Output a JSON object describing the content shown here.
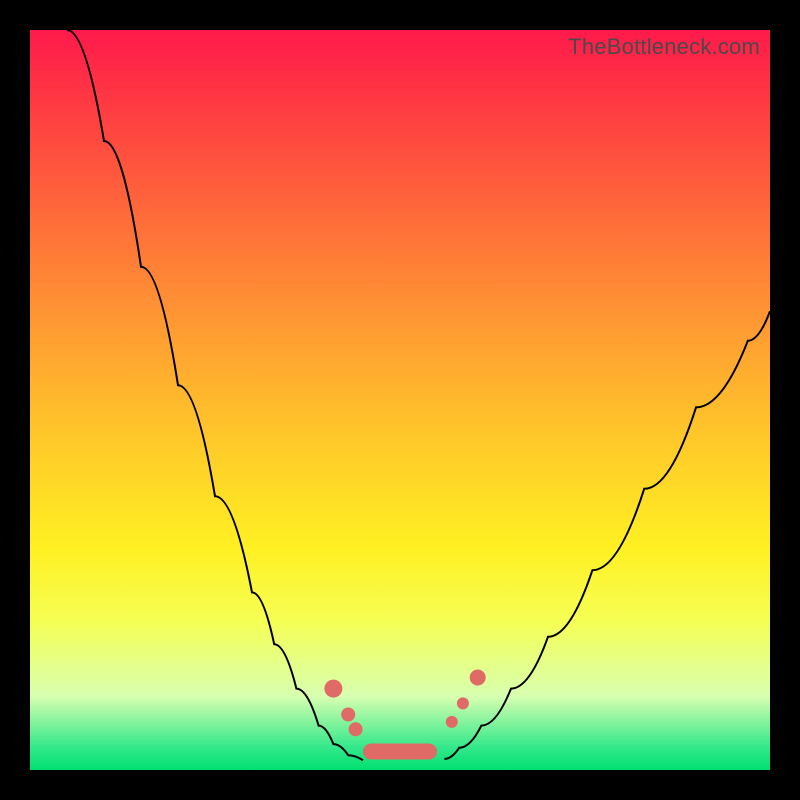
{
  "watermark": "TheBottleneck.com",
  "chart_data": {
    "type": "line",
    "title": "",
    "xlabel": "",
    "ylabel": "",
    "xlim": [
      0,
      100
    ],
    "ylim": [
      0,
      100
    ],
    "grid": false,
    "legend": false,
    "series": [
      {
        "name": "left-branch",
        "x": [
          5,
          10,
          15,
          20,
          25,
          30,
          33,
          36,
          39,
          41,
          43,
          45
        ],
        "y": [
          100,
          85,
          68,
          52,
          37,
          24,
          17,
          11,
          6,
          3.5,
          2,
          1.3
        ]
      },
      {
        "name": "right-branch",
        "x": [
          56,
          58,
          61,
          65,
          70,
          76,
          83,
          90,
          97,
          100
        ],
        "y": [
          1.5,
          3,
          6,
          11,
          18,
          27,
          38,
          49,
          58,
          62
        ]
      }
    ],
    "markers": {
      "left_descent": [
        {
          "x": 41,
          "y": 11
        },
        {
          "x": 43,
          "y": 7.5
        },
        {
          "x": 44,
          "y": 5.5
        }
      ],
      "right_ascent": [
        {
          "x": 57,
          "y": 6.5
        },
        {
          "x": 58.5,
          "y": 9
        },
        {
          "x": 60.5,
          "y": 12.5
        }
      ],
      "bottom_pill": {
        "x_start": 45,
        "x_end": 55,
        "y": 2.5
      }
    },
    "gradient_stops": [
      {
        "pct": 0,
        "color": "#ff1a4b"
      },
      {
        "pct": 10,
        "color": "#ff3a42"
      },
      {
        "pct": 25,
        "color": "#ff6a3a"
      },
      {
        "pct": 40,
        "color": "#ff9a32"
      },
      {
        "pct": 55,
        "color": "#ffc82a"
      },
      {
        "pct": 70,
        "color": "#fff022"
      },
      {
        "pct": 80,
        "color": "#f5ff55"
      },
      {
        "pct": 90,
        "color": "#d8ffb0"
      },
      {
        "pct": 97,
        "color": "#32e88a"
      },
      {
        "pct": 100,
        "color": "#00e070"
      }
    ]
  }
}
